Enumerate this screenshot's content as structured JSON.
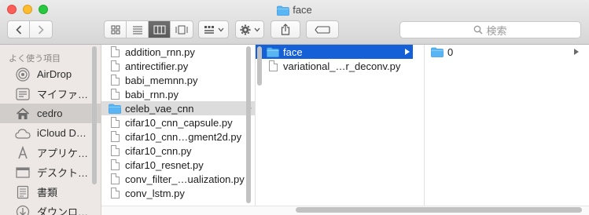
{
  "window": {
    "title": "face"
  },
  "search": {
    "placeholder": "検索"
  },
  "sidebar": {
    "header": "よく使う項目",
    "items": [
      {
        "label": "AirDrop",
        "icon": "airdrop-icon"
      },
      {
        "label": "マイファ…",
        "icon": "my-files-icon"
      },
      {
        "label": "cedro",
        "icon": "home-icon",
        "selected": true
      },
      {
        "label": "iCloud D…",
        "icon": "icloud-icon"
      },
      {
        "label": "アプリケ…",
        "icon": "applications-icon"
      },
      {
        "label": "デスクト…",
        "icon": "desktop-icon"
      },
      {
        "label": "書類",
        "icon": "documents-icon"
      },
      {
        "label": "ダウンロ…",
        "icon": "downloads-icon"
      }
    ]
  },
  "column1": {
    "items": [
      {
        "label": "addition_rnn.py",
        "type": "file"
      },
      {
        "label": "antirectifier.py",
        "type": "file"
      },
      {
        "label": "babi_memnn.py",
        "type": "file"
      },
      {
        "label": "babi_rnn.py",
        "type": "file"
      },
      {
        "label": "celeb_vae_cnn",
        "type": "folder",
        "selected": true
      },
      {
        "label": "cifar10_cnn_capsule.py",
        "type": "file"
      },
      {
        "label": "cifar10_cnn…gment2d.py",
        "type": "file"
      },
      {
        "label": "cifar10_cnn.py",
        "type": "file"
      },
      {
        "label": "cifar10_resnet.py",
        "type": "file"
      },
      {
        "label": "conv_filter_…ualization.py",
        "type": "file"
      },
      {
        "label": "conv_lstm.py",
        "type": "file"
      }
    ]
  },
  "column2": {
    "items": [
      {
        "label": "face",
        "type": "folder",
        "selected": true
      },
      {
        "label": "variational_…r_deconv.py",
        "type": "file"
      }
    ]
  },
  "column3": {
    "items": [
      {
        "label": "0",
        "type": "folder"
      }
    ]
  },
  "colors": {
    "selection_blue": "#1560d6",
    "folder_blue": "#5ab5f4",
    "sidebar_bg": "#ede8e5"
  }
}
